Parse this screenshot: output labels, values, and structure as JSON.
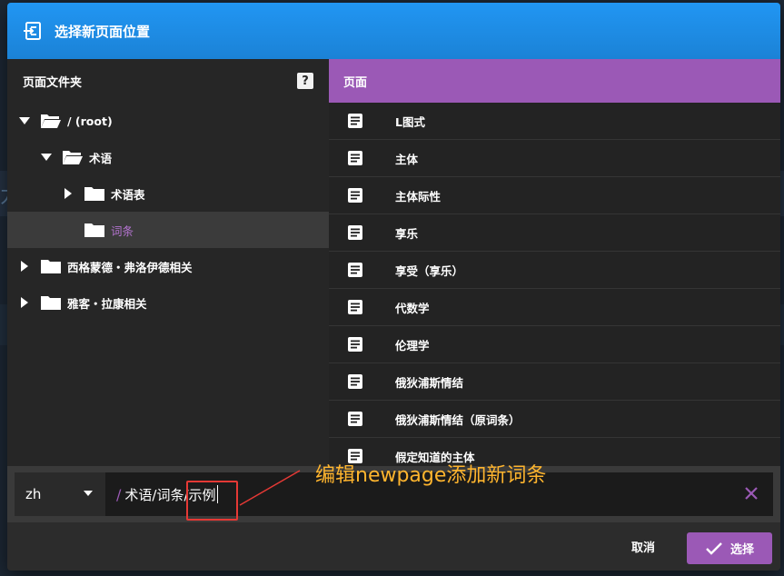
{
  "dialog": {
    "title": "选择新页面位置",
    "colors": {
      "titlebar": "#2196f3",
      "accent": "#9b59b6",
      "selected_text": "#b574d1",
      "annotation": "#ffb52e",
      "highlight_box": "#e53935"
    }
  },
  "folders_panel": {
    "header": "页面文件夹",
    "help_label": "?",
    "tree": [
      {
        "label": "/ (root)",
        "expanded": true,
        "depth": 0,
        "has_children": true,
        "selected": false,
        "icon": "folder-open-icon"
      },
      {
        "label": "术语",
        "expanded": true,
        "depth": 1,
        "has_children": true,
        "selected": false,
        "icon": "folder-open-icon"
      },
      {
        "label": "术语表",
        "expanded": false,
        "depth": 2,
        "has_children": true,
        "selected": false,
        "icon": "folder-icon"
      },
      {
        "label": "词条",
        "expanded": false,
        "depth": 2,
        "has_children": false,
        "selected": true,
        "icon": "folder-icon"
      },
      {
        "label": "西格蒙德・弗洛伊德相关",
        "expanded": false,
        "depth": 0,
        "has_children": true,
        "selected": false,
        "icon": "folder-icon"
      },
      {
        "label": "雅客・拉康相关",
        "expanded": false,
        "depth": 0,
        "has_children": true,
        "selected": false,
        "icon": "folder-icon"
      }
    ]
  },
  "pages_panel": {
    "header": "页面",
    "pages": [
      "L图式",
      "主体",
      "主体际性",
      "享乐",
      "享受（享乐）",
      "代数学",
      "伦理学",
      "俄狄浦斯情结",
      "俄狄浦斯情结（原词条）",
      "假定知道的主体"
    ]
  },
  "path_bar": {
    "locale": "zh",
    "prefix": "/",
    "path": "术语/词条/示例"
  },
  "footer": {
    "cancel_label": "取消",
    "select_label": "选择"
  },
  "annotation": {
    "text": "编辑newpage添加新词条"
  },
  "background": {
    "partial_char": "力"
  }
}
